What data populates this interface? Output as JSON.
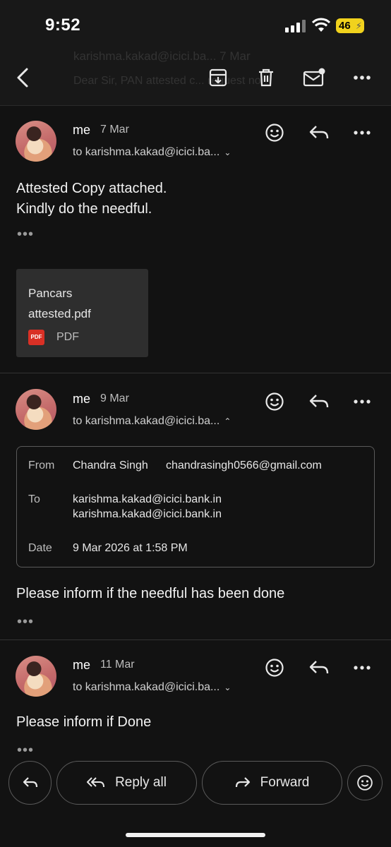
{
  "status_bar": {
    "time": "9:52",
    "battery": "46"
  },
  "top_bar": {
    "ghost_subject": "karishma.kakad@icici.ba...   7 Mar",
    "ghost_snippet": "Dear Sir, PAN attested c... request no"
  },
  "messages": [
    {
      "sender": "me",
      "date": "7 Mar",
      "recipient": "to karishma.kakad@icici.ba...",
      "body_line1": "Attested Copy attached.",
      "body_line2": "Kindly do the needful.",
      "more": "•••",
      "attachment": {
        "name_line1": "Pancars",
        "name_line2": "attested.pdf",
        "badge": "PDF",
        "type": "PDF"
      }
    },
    {
      "sender": "me",
      "date": "9 Mar",
      "recipient": "to karishma.kakad@icici.ba...",
      "details": {
        "from_label": "From",
        "from_name": "Chandra Singh",
        "from_email": "chandrasingh0566@gmail.com",
        "to_label": "To",
        "to_1": "karishma.kakad@icici.bank.in",
        "to_2": "karishma.kakad@icici.bank.in",
        "date_label": "Date",
        "date_value": "9 Mar 2026 at 1:58 PM"
      },
      "body": "Please inform if the needful has been done",
      "more": "•••"
    },
    {
      "sender": "me",
      "date": "11 Mar",
      "recipient": "to karishma.kakad@icici.ba...",
      "body": "Please inform if Done",
      "more": "•••"
    }
  ],
  "bottom_bar": {
    "reply_all": "Reply all",
    "forward": "Forward"
  },
  "icons": [
    "back-arrow-icon",
    "archive-icon",
    "trash-icon",
    "mark-unread-icon",
    "more-icon",
    "emoji-icon",
    "reply-icon",
    "reply-all-icon",
    "forward-icon",
    "chevron-down-icon",
    "chevron-up-icon"
  ],
  "colors": {
    "background": "#121212",
    "battery": "#f1d21d",
    "pdf_badge": "#d93025"
  }
}
